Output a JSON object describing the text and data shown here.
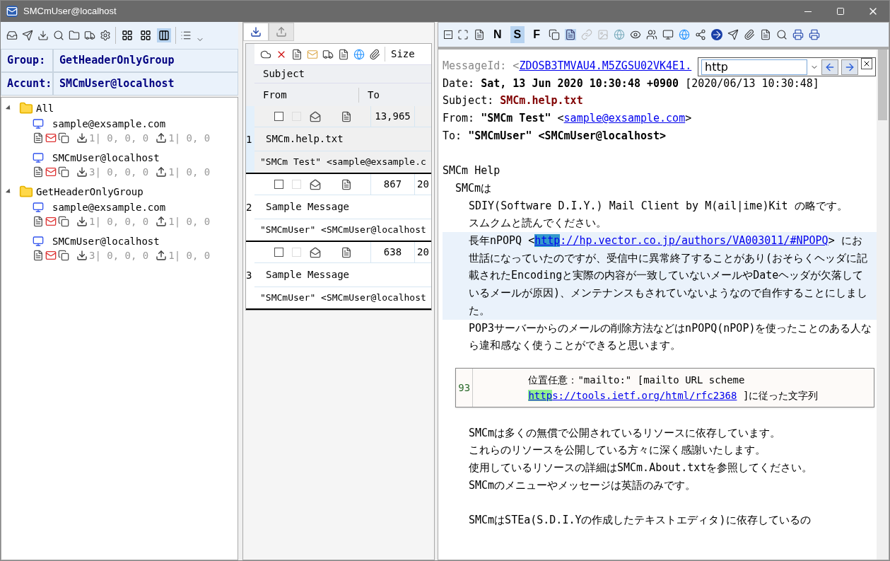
{
  "window": {
    "title": "SMCmUser@localhost"
  },
  "accounts_pane": {
    "layout_buttons": [
      {
        "selected": false
      },
      {
        "selected": false
      },
      {
        "selected": true
      }
    ],
    "group": {
      "label": "Group:",
      "value": "GetHeaderOnlyGroup"
    },
    "account": {
      "label": "Accunt:",
      "value": "SMCmUser@localhost"
    },
    "tree": [
      {
        "name": "All",
        "expanded": true,
        "children": [
          {
            "name": "sample@exsample.com",
            "received": "1| 0, 0, 0",
            "sent": "1| 0, 0"
          },
          {
            "name": "SMCmUser@localhost",
            "received": "3| 0, 0, 0",
            "sent": "1| 0, 0"
          }
        ]
      },
      {
        "name": "GetHeaderOnlyGroup",
        "expanded": true,
        "children": [
          {
            "name": "sample@exsample.com",
            "received": "1| 0, 0, 0",
            "sent": "1| 0, 0"
          },
          {
            "name": "SMCmUser@localhost",
            "received": "3| 0, 0, 0",
            "sent": "1| 0, 0"
          }
        ]
      }
    ]
  },
  "message_list": {
    "tabs": [
      {
        "kind": "inbox",
        "selected": true
      },
      {
        "kind": "outbox",
        "selected": false
      }
    ],
    "columns": {
      "size": "Size",
      "subject": "Subject",
      "from": "From",
      "to": "To"
    },
    "rows": [
      {
        "number": "1",
        "selected": true,
        "checked": false,
        "size": "13,965",
        "date": "",
        "subject": "SMCm.help.txt",
        "from": "\"SMCm Test\" <sample@exsample.c"
      },
      {
        "number": "2",
        "selected": false,
        "checked": false,
        "size": "867",
        "date": "20",
        "subject": "Sample Message",
        "from": "\"SMCmUser\" <SMCmUser@localhost"
      },
      {
        "number": "3",
        "selected": false,
        "checked": false,
        "size": "638",
        "date": "20",
        "subject": "Sample Message",
        "from": "\"SMCmUser\" <SMCmUser@localhost"
      }
    ]
  },
  "reader": {
    "view_modes": [
      {
        "label": "N",
        "selected": false
      },
      {
        "label": "S",
        "selected": true
      },
      {
        "label": "F",
        "selected": false
      }
    ],
    "find": {
      "value": "http"
    },
    "headers": [
      {
        "label": "MessageId:",
        "kind": "muted",
        "segments": [
          {
            "kind": "text",
            "text": "<"
          },
          {
            "kind": "link",
            "text": "ZDOSB3TMVAU4.M5ZGSU02VK4E1.",
            "match": false
          }
        ]
      },
      {
        "label": "Date:",
        "kind": "plain",
        "segments": [
          {
            "kind": "bold",
            "text": "Sat, 13 Jun 2020 10:30:48 +0900"
          },
          {
            "kind": "text",
            "text": " [2020/06/13 10:30:48]"
          }
        ]
      },
      {
        "label": "Subject:",
        "kind": "plain",
        "segments": [
          {
            "kind": "subject",
            "text": "SMCm.help.txt"
          }
        ]
      },
      {
        "label": "From:",
        "kind": "plain",
        "segments": [
          {
            "kind": "bold",
            "text": "\"SMCm Test\" "
          },
          {
            "kind": "text",
            "text": "<"
          },
          {
            "kind": "link",
            "text": "sample@exsample.com",
            "match": false
          },
          {
            "kind": "text",
            "text": ">"
          }
        ]
      },
      {
        "label": "To:",
        "kind": "plain",
        "segments": [
          {
            "kind": "bold",
            "text": "\"SMCmUser\" <SMCmUser@localhost>"
          }
        ]
      }
    ],
    "body": [
      {
        "kind": "gap"
      },
      {
        "kind": "title",
        "highlighted": false,
        "segments": [
          {
            "kind": "text",
            "text": "SMCm Help"
          }
        ]
      },
      {
        "kind": "section",
        "highlighted": false,
        "segments": [
          {
            "kind": "text",
            "text": "SMCmは"
          }
        ]
      },
      {
        "kind": "text",
        "highlighted": false,
        "segments": [
          {
            "kind": "text",
            "text": "SDIY(Software D.I.Y.) Mail Client by M(ail|ime)Kit の略です。"
          }
        ]
      },
      {
        "kind": "text",
        "highlighted": false,
        "segments": [
          {
            "kind": "text",
            "text": "スムクムと読んでください。"
          }
        ]
      },
      {
        "kind": "text",
        "highlighted": true,
        "segments": [
          {
            "kind": "text",
            "text": "長年nPOPQ <"
          },
          {
            "kind": "link",
            "text": "http",
            "match": true
          },
          {
            "kind": "link",
            "text": "://hp.vector.co.jp/authors/VA003011/#NPOPQ",
            "match": false
          },
          {
            "kind": "text",
            "text": "> にお世話になっていたのですが、受信中に異常終了することがあり(おそらくヘッダに記載されたEncodingと実際の内容が一致していないメールやDateヘッダが欠落しているメールが原因)、メンテナンスもされていないようなので自作することにしました。"
          }
        ]
      },
      {
        "kind": "text",
        "highlighted": false,
        "segments": [
          {
            "kind": "text",
            "text": "POP3サーバーからのメールの削除方法などはnPOPQ(nPOP)を使ったことのある人なら違和感なく使うことができると思います。"
          }
        ]
      },
      {
        "kind": "gap"
      },
      {
        "kind": "gap"
      },
      {
        "kind": "gap"
      },
      {
        "kind": "gap"
      },
      {
        "kind": "text",
        "highlighted": false,
        "segments": [
          {
            "kind": "text",
            "text": "SMCmは多くの無償で公開されているリソースに依存しています。"
          }
        ]
      },
      {
        "kind": "text",
        "highlighted": false,
        "segments": [
          {
            "kind": "text",
            "text": "これらのリソースを公開している方々に深く感謝いたします。"
          }
        ]
      },
      {
        "kind": "text",
        "highlighted": false,
        "segments": [
          {
            "kind": "text",
            "text": "使用しているリソースの詳細はSMCm.About.txtを参照してください。"
          }
        ]
      },
      {
        "kind": "text",
        "highlighted": false,
        "segments": [
          {
            "kind": "text",
            "text": "SMCmのメニューやメッセージは英語のみです。"
          }
        ]
      },
      {
        "kind": "gap"
      },
      {
        "kind": "text",
        "highlighted": false,
        "segments": [
          {
            "kind": "text",
            "text": "SMCmはSTEa(S.D.I.Yの作成したテキストエディタ)に依存しているの"
          }
        ]
      }
    ],
    "tooltip": {
      "line_number": "93",
      "segments": [
        {
          "kind": "text",
          "text": "位置任意：\"mailto:\" [mailto URL scheme "
        },
        {
          "kind": "link",
          "text": "http",
          "match": true
        },
        {
          "kind": "link",
          "text": "s://tools.ietf.org/",
          "match": false
        },
        {
          "kind": "link",
          "text": "html/rfc2368",
          "match": false
        },
        {
          "kind": "text",
          "text": " ]に従った文字列"
        }
      ]
    }
  }
}
